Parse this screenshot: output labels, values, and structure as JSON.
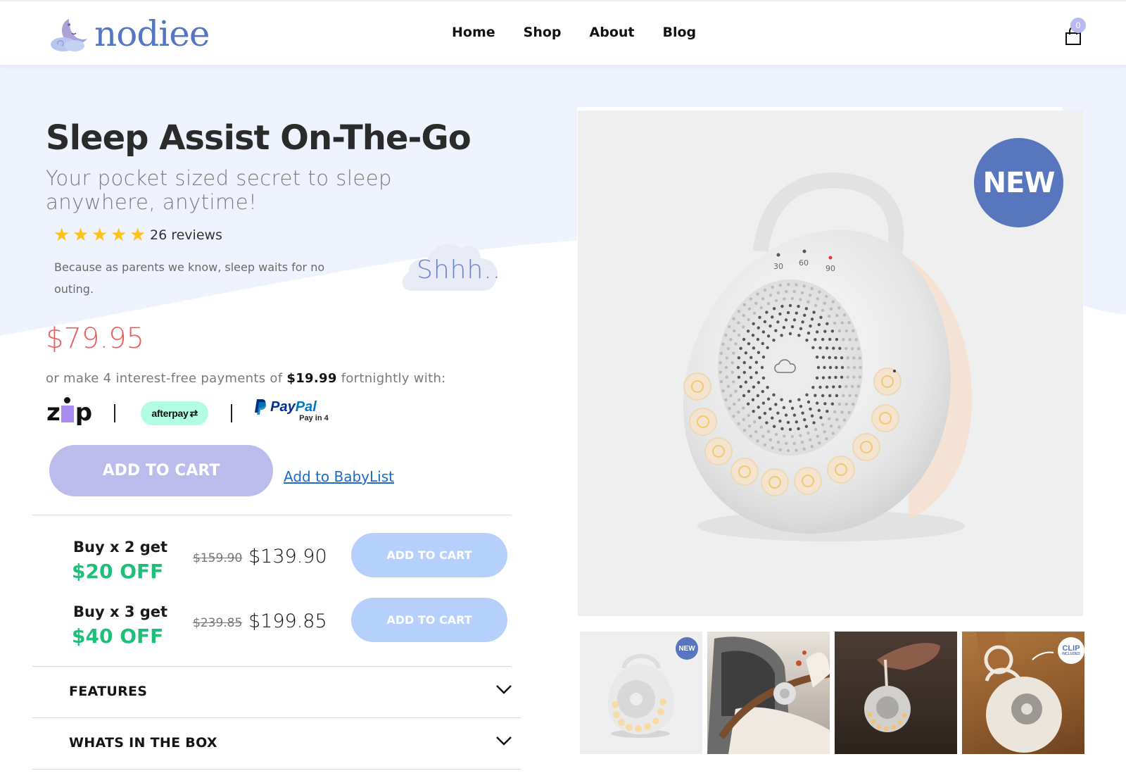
{
  "brand": {
    "name": "nodiee",
    "color": "#5576c4"
  },
  "nav": {
    "items": [
      "Home",
      "Shop",
      "About",
      "Blog"
    ]
  },
  "cart": {
    "count": "0"
  },
  "product": {
    "title": "Sleep Assist On-The-Go",
    "subtitle": "Your pocket sized secret to sleep anywhere, anytime!",
    "rating": {
      "stars": 5,
      "max": 5,
      "reviews_label": "26 reviews"
    },
    "tagline": "Because as parents we know, sleep waits for no outing.",
    "cloud_text": "Shhh..",
    "price": "$79.95",
    "price_color": "#e85d5d",
    "installments": {
      "prefix": "or make 4 interest-free payments of",
      "amount": "$19.99",
      "suffix": "fortnightly with:"
    },
    "payment_providers": {
      "zip": "zip",
      "afterpay": "afterpay",
      "paypal_pay": "Pay",
      "paypal_pal": "Pal",
      "paypal_sub": "Pay in 4"
    },
    "add_to_cart": "ADD TO CART",
    "babylist": "Add to BabyList",
    "image_badge": "NEW",
    "timer_labels": [
      "30",
      "60",
      "90"
    ]
  },
  "bundles": [
    {
      "label": "Buy x 2 get",
      "discount": "$20 OFF",
      "old_price": "$159.90",
      "new_price": "$139.90",
      "button": "ADD TO CART"
    },
    {
      "label": "Buy x 3 get",
      "discount": "$40 OFF",
      "old_price": "$239.85",
      "new_price": "$199.85",
      "button": "ADD TO CART"
    }
  ],
  "accordions": [
    {
      "label": "FEATURES"
    },
    {
      "label": "WHATS IN THE BOX"
    }
  ],
  "thumbnails": [
    {
      "name": "product-studio",
      "badge": "NEW"
    },
    {
      "name": "stroller-lifestyle",
      "badge": ""
    },
    {
      "name": "hand-holding",
      "badge": ""
    },
    {
      "name": "bag-clip",
      "badge": "CLIP",
      "badge_sub": "INCLUDED"
    }
  ]
}
